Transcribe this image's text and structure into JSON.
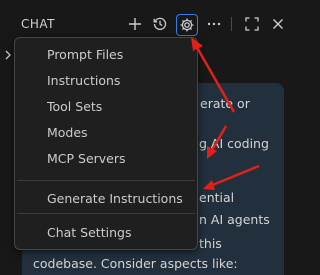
{
  "header": {
    "title": "CHAT"
  },
  "menu": {
    "items": [
      {
        "label": "Prompt Files"
      },
      {
        "label": "Instructions"
      },
      {
        "label": "Tool Sets"
      },
      {
        "label": "Modes"
      },
      {
        "label": "MCP Servers"
      },
      {
        "label": "Generate Instructions"
      },
      {
        "label": "Chat Settings"
      }
    ]
  },
  "chat": {
    "lines": [
      "erate or",
      "g AI coding",
      "ential",
      "n AI agents",
      "this",
      "codebase. Consider aspects like:"
    ]
  },
  "icons": {
    "header": [
      "plus-icon",
      "history-icon",
      "gear-icon",
      "more-icon",
      "maximize-icon",
      "close-icon"
    ],
    "gutter": "chevron-right-icon"
  },
  "colors": {
    "background": "#181818",
    "menu_background": "#1f1f1f",
    "menu_border": "#454545",
    "bubble_background": "#22303d",
    "focus_ring": "#3b7be6",
    "annotation_arrow": "#e0201b"
  }
}
